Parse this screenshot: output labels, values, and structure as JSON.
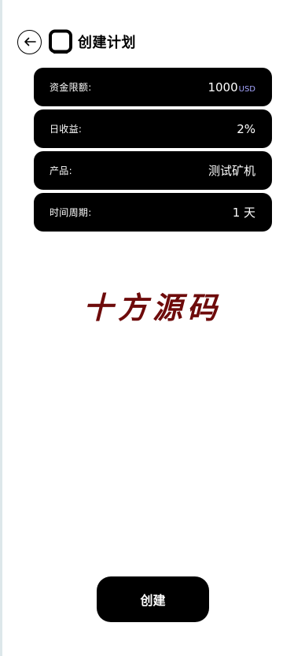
{
  "header": {
    "title": "创建计划",
    "back_icon": "arrow-left-icon",
    "app_icon": "square-frame-icon"
  },
  "rows": [
    {
      "label": "资金限额:",
      "value": "1000",
      "unit": "USD"
    },
    {
      "label": "日收益:",
      "value": "2%"
    },
    {
      "label": "产品:",
      "value": "测试矿机"
    },
    {
      "label": "时间周期:",
      "value": "1 天"
    }
  ],
  "watermark": "十方源码",
  "create_button": "创建",
  "colors": {
    "row_bg": "#000000",
    "unit": "#a6a6ff",
    "watermark": "#6e0b0b"
  }
}
